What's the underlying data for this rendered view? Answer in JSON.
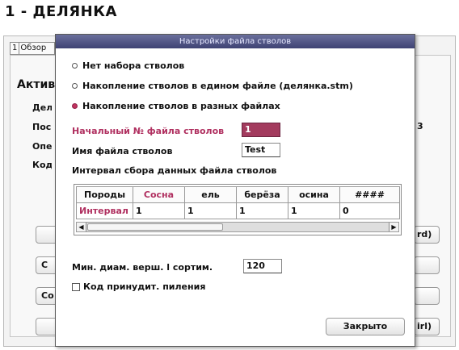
{
  "background": {
    "page_title": "1 - ДЕЛЯНКА",
    "tab": {
      "number": "1",
      "label": "Обзор"
    },
    "section_heading": "Актив",
    "labels": [
      "Дел",
      "Пос",
      "Опе",
      "Код"
    ],
    "right_text": "3",
    "buttons": [
      "С",
      "Со"
    ],
    "right_buttons": [
      "rd)",
      "irl)"
    ]
  },
  "dialog": {
    "title": "Настройки файла стволов",
    "options": [
      {
        "label": "Нет набора стволов",
        "selected": false
      },
      {
        "label": "Накопление стволов в едином файле (делянка.stm)",
        "selected": false
      },
      {
        "label": "Накопление стволов в разных файлах",
        "selected": true
      }
    ],
    "start_file_label": "Начальный № файла стволов",
    "start_file_value": "1",
    "file_name_label": "Имя файла стволов",
    "file_name_value": "Test",
    "interval_heading": "Интервал сбора данных файла стволов",
    "grid": {
      "headers": [
        "Породы",
        "Сосна",
        "ель",
        "берёза",
        "осина",
        "####"
      ],
      "row_label": "Интервал",
      "row_values": [
        "1",
        "1",
        "1",
        "1",
        "0"
      ]
    },
    "min_diam_label": "Мин. диам. верш. l сортим.",
    "min_diam_value": "120",
    "force_cut_label": "Код принудит. пиления",
    "close_label": "Закрыто"
  },
  "colors": {
    "accent": "#b03060",
    "selected_input": "#a33b5e",
    "titlebar": "#3e4273"
  }
}
